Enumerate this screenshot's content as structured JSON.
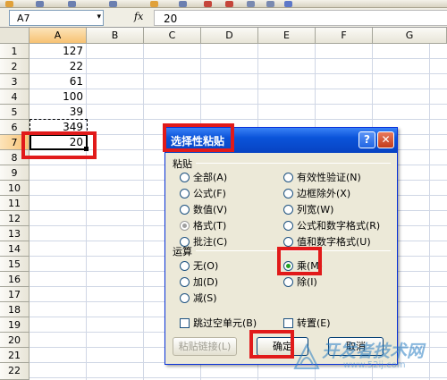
{
  "formula_bar": {
    "name_box": "A7",
    "name_box_arrow": "▾",
    "fx": "fx",
    "formula_value": "20"
  },
  "grid": {
    "columns": [
      "A",
      "B",
      "C",
      "D",
      "E",
      "F",
      "G"
    ],
    "rows": [
      "1",
      "2",
      "3",
      "4",
      "5",
      "6",
      "7",
      "8",
      "9",
      "10",
      "11",
      "12",
      "13",
      "14",
      "15",
      "16",
      "17",
      "18",
      "19",
      "20",
      "21",
      "22"
    ],
    "selected_column": "A",
    "selected_row": "7",
    "cells_a": [
      "127",
      "22",
      "61",
      "100",
      "39",
      "349",
      "20"
    ]
  },
  "dialog": {
    "title": "选择性粘贴",
    "help": "?",
    "close": "✕",
    "paste_group": "粘贴",
    "paste_options_left": [
      "全部(A)",
      "公式(F)",
      "数值(V)",
      "格式(T)",
      "批注(C)"
    ],
    "paste_options_right": [
      "有效性验证(N)",
      "边框除外(X)",
      "列宽(W)",
      "公式和数字格式(R)",
      "值和数字格式(U)"
    ],
    "paste_selected": "格式(T)",
    "operation_group": "运算",
    "operation_left": [
      "无(O)",
      "加(D)",
      "减(S)"
    ],
    "operation_right": [
      "乘(M)",
      "除(I)"
    ],
    "operation_selected": "乘(M)",
    "skip_blanks": "跳过空单元(B)",
    "transpose": "转置(E)",
    "paste_link": "粘贴链接(L)",
    "ok": "确定",
    "cancel": "取消"
  },
  "watermark": {
    "main": "开发者技术网",
    "url": "www.52ij.com"
  }
}
